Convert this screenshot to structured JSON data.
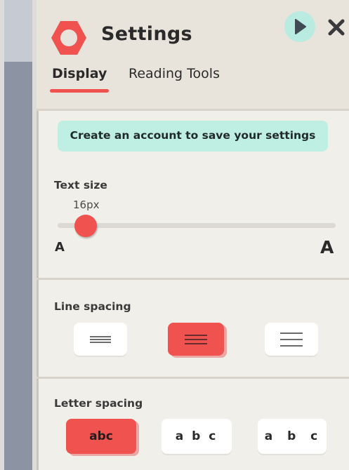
{
  "header": {
    "title": "Settings",
    "logo_icon": "hexagon-ring-logo",
    "play_icon": "play-icon",
    "close_icon": "close-icon"
  },
  "tabs": [
    {
      "label": "Display",
      "active": true
    },
    {
      "label": "Reading Tools",
      "active": false
    }
  ],
  "banner": {
    "text": "Create an account to save your settings"
  },
  "text_size": {
    "label": "Text size",
    "value": "16px",
    "slider_fraction": 0.1,
    "min_label": "A",
    "max_label": "A"
  },
  "line_spacing": {
    "label": "Line spacing",
    "options": [
      {
        "name": "compact",
        "selected": false
      },
      {
        "name": "normal",
        "selected": true
      },
      {
        "name": "wide",
        "selected": false
      }
    ]
  },
  "letter_spacing": {
    "label": "Letter spacing",
    "options": [
      {
        "label": "abc",
        "selected": true
      },
      {
        "label": "a b c",
        "selected": false
      },
      {
        "label": "a  b  c",
        "selected": false
      }
    ]
  },
  "colors": {
    "accent": "#f0524f",
    "banner_bg": "#bfeee3",
    "play_bg": "#b9ebe1"
  }
}
